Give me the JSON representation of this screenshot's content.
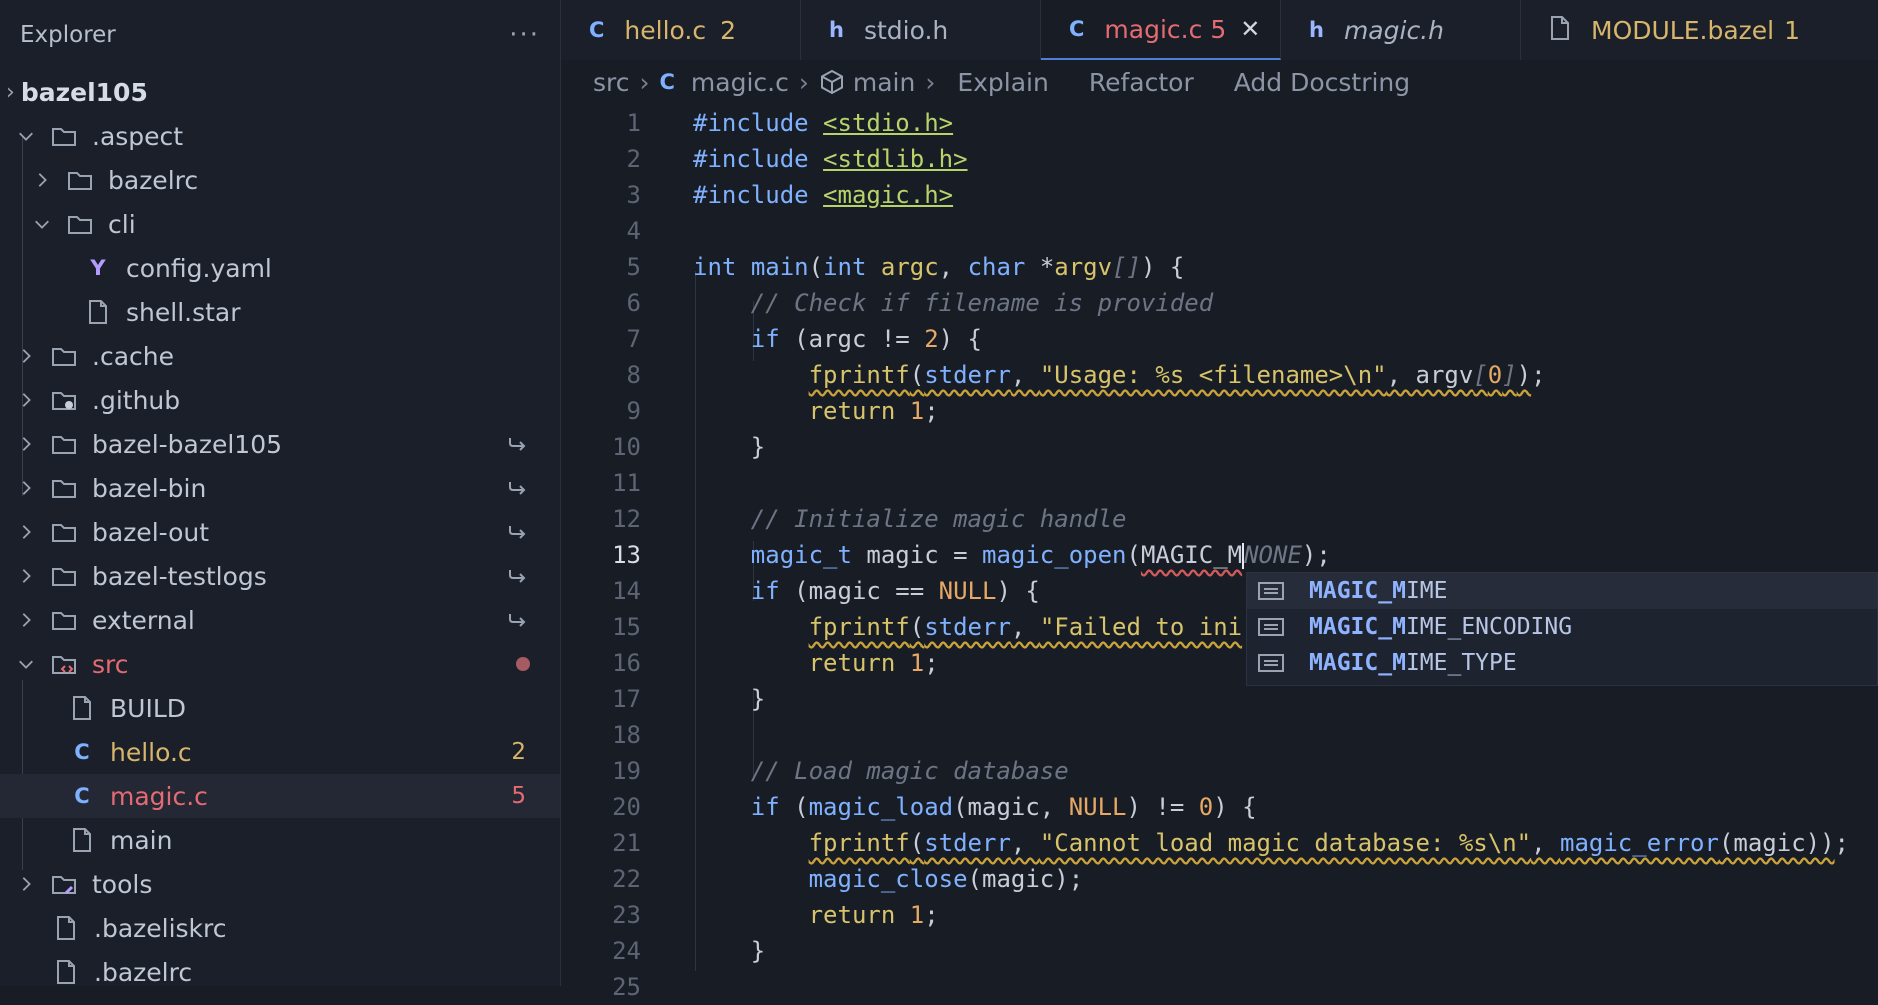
{
  "sidebar": {
    "title": "Explorer",
    "more": "···",
    "root": "bazel105",
    "items": [
      {
        "label": ".aspect",
        "count": ""
      },
      {
        "label": "bazelrc",
        "count": ""
      },
      {
        "label": "cli",
        "count": ""
      },
      {
        "label": "config.yaml",
        "count": ""
      },
      {
        "label": "shell.star",
        "count": ""
      },
      {
        "label": ".cache",
        "count": ""
      },
      {
        "label": ".github",
        "count": ""
      },
      {
        "label": "bazel-bazel105",
        "count": ""
      },
      {
        "label": "bazel-bin",
        "count": ""
      },
      {
        "label": "bazel-out",
        "count": ""
      },
      {
        "label": "bazel-testlogs",
        "count": ""
      },
      {
        "label": "external",
        "count": ""
      },
      {
        "label": "src",
        "count": ""
      },
      {
        "label": "BUILD",
        "count": ""
      },
      {
        "label": "hello.c",
        "count": "2"
      },
      {
        "label": "magic.c",
        "count": "5"
      },
      {
        "label": "main",
        "count": ""
      },
      {
        "label": "tools",
        "count": ""
      },
      {
        "label": ".bazeliskrc",
        "count": ""
      },
      {
        "label": ".bazelrc",
        "count": ""
      }
    ]
  },
  "tabs": [
    {
      "label": "hello.c",
      "icon": "C",
      "count": "2"
    },
    {
      "label": "stdio.h",
      "icon": "h",
      "count": ""
    },
    {
      "label": "magic.c",
      "icon": "C",
      "count": "5"
    },
    {
      "label": "magic.h",
      "icon": "h",
      "count": ""
    },
    {
      "label": "MODULE.bazel",
      "icon": "file",
      "count": "1"
    }
  ],
  "breadcrumb": {
    "parts": [
      "src",
      "magic.c",
      "main"
    ],
    "actions": [
      "Explain",
      "Refactor",
      "Add Docstring"
    ]
  },
  "editor": {
    "line_numbers": [
      "1",
      "2",
      "3",
      "4",
      "5",
      "6",
      "7",
      "8",
      "9",
      "10",
      "11",
      "12",
      "13",
      "14",
      "15",
      "16",
      "17",
      "18",
      "19",
      "20",
      "21",
      "22",
      "23",
      "24",
      "25"
    ],
    "current_line": "13"
  },
  "suggestions": [
    {
      "prefix": "MAGIC_M",
      "rest": "IME"
    },
    {
      "prefix": "MAGIC_M",
      "rest": "IME_ENCODING"
    },
    {
      "prefix": "MAGIC_M",
      "rest": "IME_TYPE"
    }
  ],
  "colors": {
    "accent": "#4f7fd9",
    "modified": "#d7b56a",
    "error": "#e46b73",
    "keyword": "#7fb1ff"
  }
}
